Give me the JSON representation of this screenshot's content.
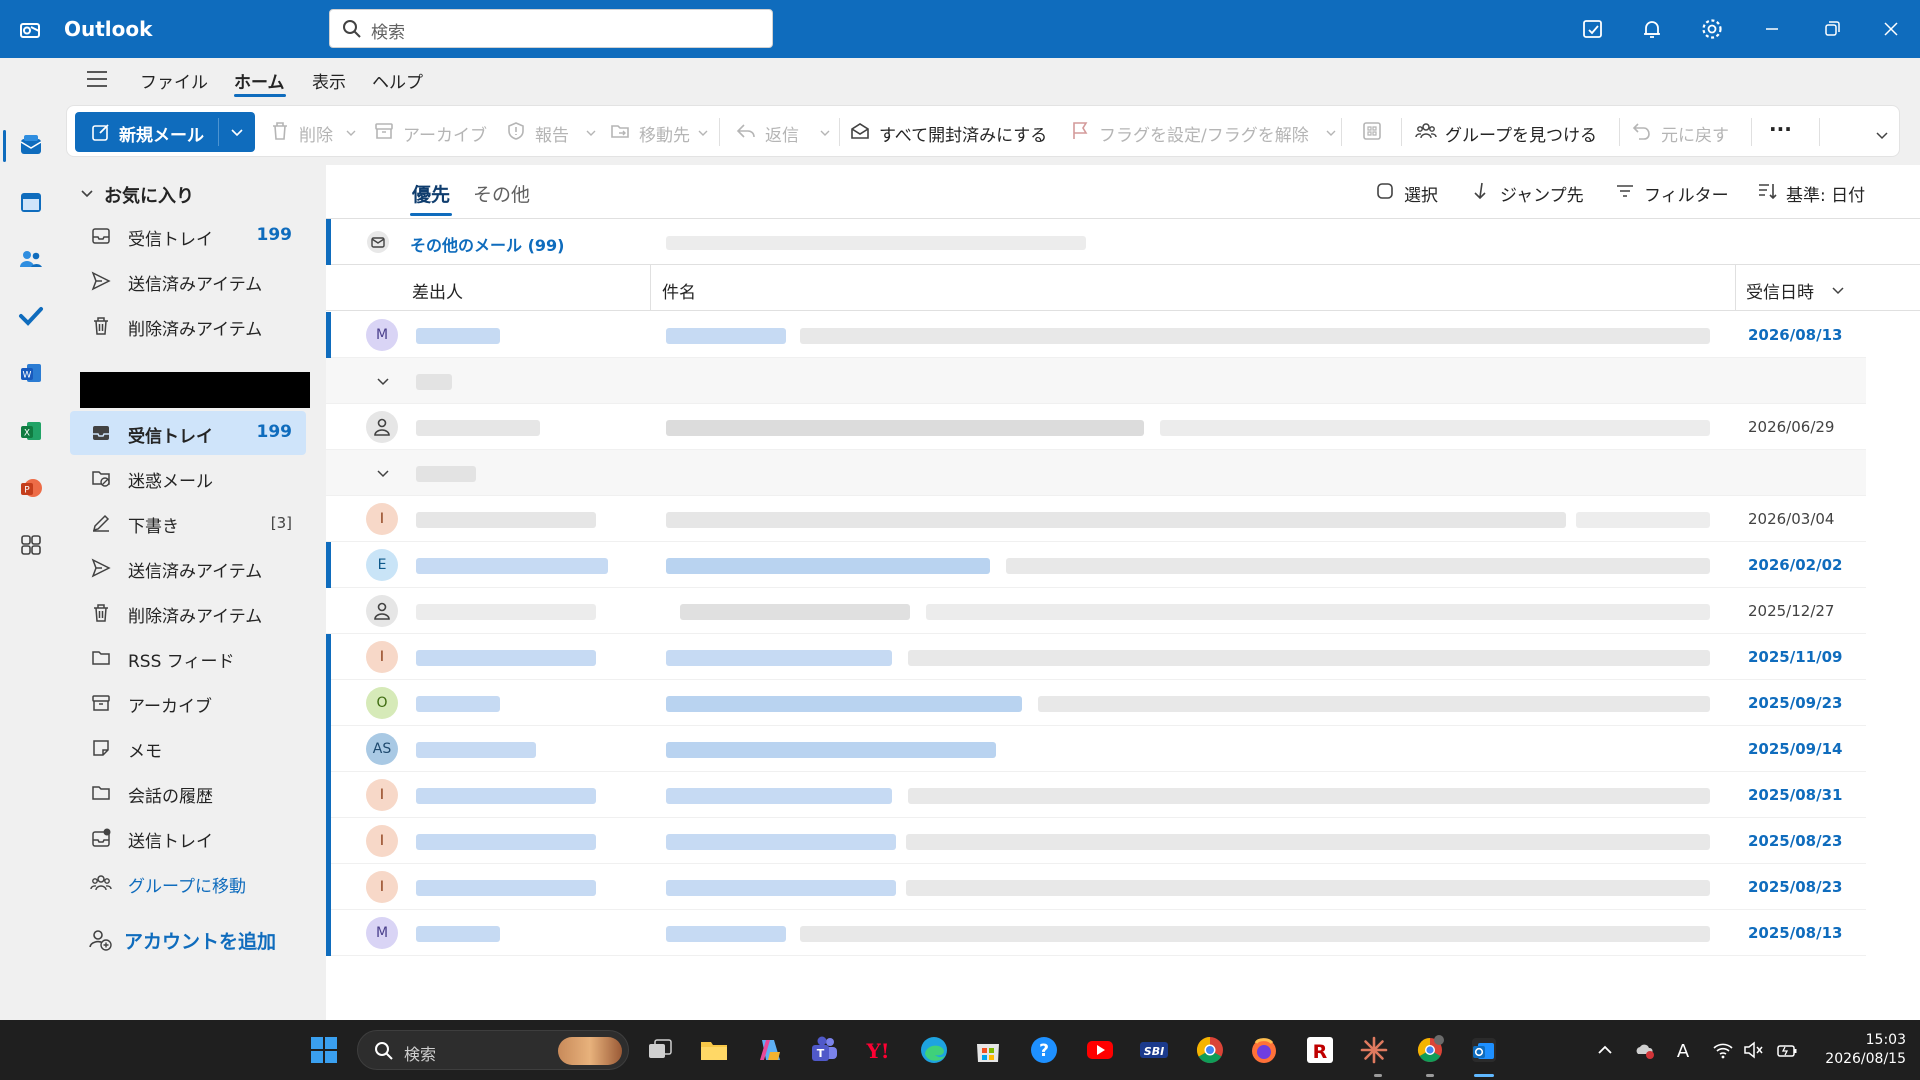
{
  "app": {
    "title": "Outlook"
  },
  "search": {
    "placeholder": "検索"
  },
  "menu": {
    "items": [
      "ファイル",
      "ホーム",
      "表示",
      "ヘルプ"
    ],
    "active": "ホーム"
  },
  "ribbon": {
    "new_mail": "新規メール",
    "delete": "削除",
    "archive": "アーカイブ",
    "report": "報告",
    "move": "移動先",
    "reply": "返信",
    "mark_all_read": "すべて開封済みにする",
    "flag": "フラグを設定/フラグを解除",
    "find_groups": "グループを見つける",
    "undo": "元に戻す",
    "more": "···"
  },
  "folders": {
    "favorites_header": "お気に入り",
    "favorites": [
      {
        "label": "受信トレイ",
        "count": "199"
      },
      {
        "label": "送信済みアイテム",
        "count": ""
      },
      {
        "label": "削除済みアイテム",
        "count": ""
      }
    ],
    "account": [
      {
        "label": "受信トレイ",
        "count": "199"
      },
      {
        "label": "迷惑メール",
        "count": ""
      },
      {
        "label": "下書き",
        "count": "[3]"
      },
      {
        "label": "送信済みアイテム",
        "count": ""
      },
      {
        "label": "削除済みアイテム",
        "count": ""
      },
      {
        "label": "RSS フィード",
        "count": ""
      },
      {
        "label": "アーカイブ",
        "count": ""
      },
      {
        "label": "メモ",
        "count": ""
      },
      {
        "label": "会話の履歴",
        "count": ""
      },
      {
        "label": "送信トレイ",
        "count": ""
      },
      {
        "label": "グループに移動",
        "count": ""
      }
    ],
    "add_account": "アカウントを追加"
  },
  "mail": {
    "tabs": [
      "優先",
      "その他"
    ],
    "toolbar": {
      "select": "選択",
      "jump": "ジャンプ先",
      "filter": "フィルター",
      "sort": "基準: 日付"
    },
    "other_mail": "その他のメール (99)",
    "columns": {
      "from": "差出人",
      "subject": "件名",
      "received": "受信日時"
    },
    "rows": [
      {
        "avatar": "M",
        "date": "2026/08/13",
        "unread": true
      },
      {
        "avatar": "",
        "date": "2026/06/29",
        "unread": false
      },
      {
        "avatar": "I",
        "date": "2026/03/04",
        "unread": false
      },
      {
        "avatar": "E",
        "date": "2026/02/02",
        "unread": true
      },
      {
        "avatar": "",
        "date": "2025/12/27",
        "unread": false
      },
      {
        "avatar": "I",
        "date": "2025/11/09",
        "unread": true
      },
      {
        "avatar": "O",
        "date": "2025/09/23",
        "unread": true
      },
      {
        "avatar": "AS",
        "date": "2025/09/14",
        "unread": true
      },
      {
        "avatar": "I",
        "date": "2025/08/31",
        "unread": true
      },
      {
        "avatar": "I",
        "date": "2025/08/23",
        "unread": true
      },
      {
        "avatar": "I",
        "date": "2025/08/23",
        "unread": true
      },
      {
        "avatar": "M",
        "date": "2025/08/13",
        "unread": true
      }
    ]
  },
  "taskbar": {
    "search": "検索",
    "time": "15:03",
    "date": "2026/08/15"
  },
  "colors": {
    "accent": "#0f6cbd",
    "chrome": "#f0f0f0",
    "taskbar": "#1f1f1f"
  }
}
